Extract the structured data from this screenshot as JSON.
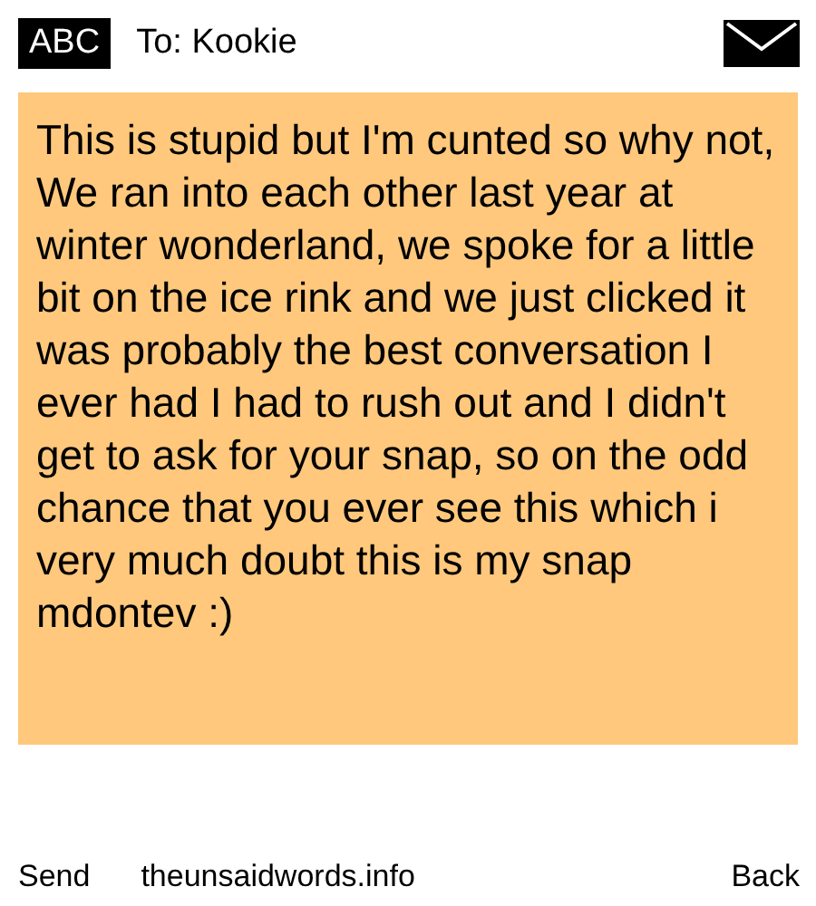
{
  "header": {
    "badge": "ABC",
    "recipient": "To: Kookie"
  },
  "message": "This is stupid but I'm cunted so why not,\nWe ran into each other last year at winter wonderland, we spoke for a little bit on the ice rink and we just clicked it was probably the best conversation I ever had I had to rush out and I didn't get to ask for your snap, so on the odd chance that you ever see this which i very much doubt this is my snap mdontev :)",
  "footer": {
    "left": "Send",
    "center": "theunsaidwords.info",
    "right": "Back"
  }
}
